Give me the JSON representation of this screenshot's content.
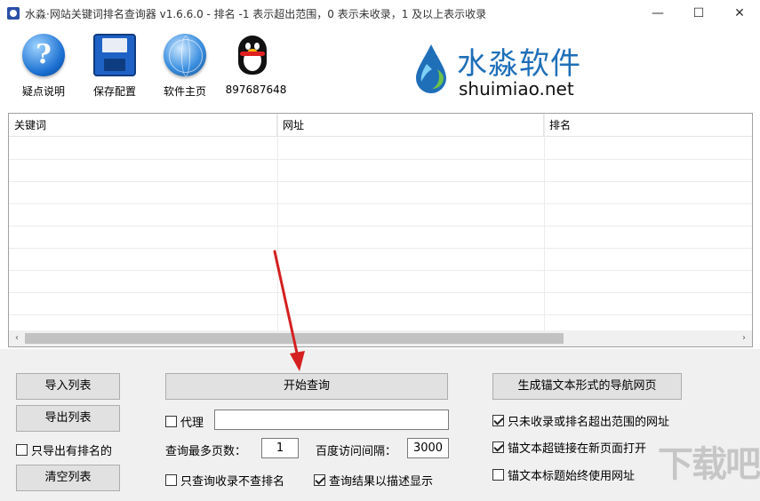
{
  "window": {
    "title": "水淼·网站关键词排名查询器 v1.6.6.0 - 排名 -1 表示超出范围，0 表示未收录，1 及以上表示收录",
    "controls": {
      "minimize": "—",
      "maximize": "☐",
      "close": "✕"
    }
  },
  "toolbar": {
    "items": [
      {
        "label": "疑点说明",
        "icon": "help-icon"
      },
      {
        "label": "保存配置",
        "icon": "save-icon"
      },
      {
        "label": "软件主页",
        "icon": "globe-icon"
      },
      {
        "label": "897687648",
        "icon": "qq-icon"
      }
    ],
    "help_glyph": "?"
  },
  "brand": {
    "name_cn": "水淼软件",
    "domain": "shuimiao.net"
  },
  "table": {
    "columns": [
      "关键词",
      "网址",
      "排名"
    ],
    "rows": []
  },
  "scrollbar": {
    "left_arrow": "‹",
    "right_arrow": "›"
  },
  "controls": {
    "import_label": "导入列表",
    "export_label": "导出列表",
    "export_ranked_only": {
      "label": "只导出有排名的",
      "checked": false
    },
    "clear_label": "清空列表",
    "start_label": "开始查询",
    "proxy": {
      "label": "代理",
      "checked": false,
      "value": ""
    },
    "max_pages_label": "查询最多页数：",
    "max_pages_value": "1",
    "interval_label": "百度访问间隔：",
    "interval_value": "3000",
    "index_only": {
      "label": "只查询收录不查排名",
      "checked": false
    },
    "desc_display": {
      "label": "查询结果以描述显示",
      "checked": true
    },
    "gen_nav_label": "生成锚文本形式的导航网页",
    "only_unindexed": {
      "label": "只未收录或排名超出范围的网址",
      "checked": true
    },
    "open_new_page": {
      "label": "锚文本超链接在新页面打开",
      "checked": true
    },
    "title_use_url": {
      "label": "锚文本标题始终使用网址",
      "checked": false
    }
  },
  "watermark": "下载吧",
  "colors": {
    "brand_blue": "#1f6fb8",
    "annotation_arrow": "#d42020",
    "panel_bg": "#f0f0f0"
  }
}
